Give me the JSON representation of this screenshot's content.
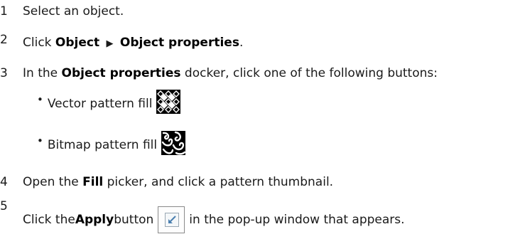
{
  "steps": [
    {
      "num": "1",
      "before": "Select an object.",
      "strong": "",
      "after": "",
      "strong2": "",
      "after2": ""
    },
    {
      "num": "2",
      "before": "Click ",
      "strong": "Object",
      "after": "",
      "strong2": "Object properties",
      "after2": "."
    },
    {
      "num": "3",
      "before": "In the ",
      "strong": "Object properties",
      "after": " docker, click one of the following buttons:"
    },
    {
      "num": "4",
      "before": "Open the ",
      "strong": "Fill",
      "after": " picker, and click a pattern thumbnail."
    },
    {
      "num": "5",
      "before": "Click the ",
      "strong": "Apply",
      "after": " button",
      "after2": "in the pop-up window that appears."
    }
  ],
  "subitems": [
    {
      "bullet": "•",
      "label": "Vector pattern fill",
      "icon": "vector-pattern-fill-icon"
    },
    {
      "bullet": "•",
      "label": "Bitmap pattern fill",
      "icon": "bitmap-pattern-fill-icon"
    }
  ],
  "arrow_glyph": "▶",
  "apply_icon": "apply-icon"
}
